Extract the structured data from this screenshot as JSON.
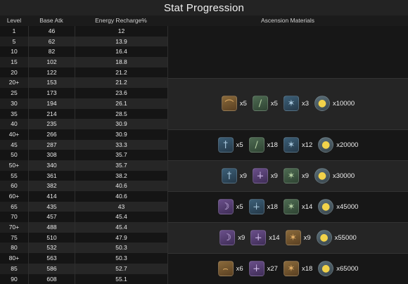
{
  "title": "Stat Progression",
  "headers": {
    "level": "Level",
    "base_atk": "Base Atk",
    "energy": "Energy Recharge%",
    "materials": "Ascension Materials"
  },
  "rows": [
    {
      "level": "1",
      "atk": "46",
      "er": "12"
    },
    {
      "level": "5",
      "atk": "62",
      "er": "13.9"
    },
    {
      "level": "10",
      "atk": "82",
      "er": "16.4"
    },
    {
      "level": "15",
      "atk": "102",
      "er": "18.8"
    },
    {
      "level": "20",
      "atk": "122",
      "er": "21.2"
    },
    {
      "level": "20+",
      "atk": "153",
      "er": "21.2"
    },
    {
      "level": "25",
      "atk": "173",
      "er": "23.6"
    },
    {
      "level": "30",
      "atk": "194",
      "er": "26.1"
    },
    {
      "level": "35",
      "atk": "214",
      "er": "28.5"
    },
    {
      "level": "40",
      "atk": "235",
      "er": "30.9"
    },
    {
      "level": "40+",
      "atk": "266",
      "er": "30.9"
    },
    {
      "level": "45",
      "atk": "287",
      "er": "33.3"
    },
    {
      "level": "50",
      "atk": "308",
      "er": "35.7"
    },
    {
      "level": "50+",
      "atk": "340",
      "er": "35.7"
    },
    {
      "level": "55",
      "atk": "361",
      "er": "38.2"
    },
    {
      "level": "60",
      "atk": "382",
      "er": "40.6"
    },
    {
      "level": "60+",
      "atk": "414",
      "er": "40.6"
    },
    {
      "level": "65",
      "atk": "435",
      "er": "43"
    },
    {
      "level": "70",
      "atk": "457",
      "er": "45.4"
    },
    {
      "level": "70+",
      "atk": "488",
      "er": "45.4"
    },
    {
      "level": "75",
      "atk": "510",
      "er": "47.9"
    },
    {
      "level": "80",
      "atk": "532",
      "er": "50.3"
    },
    {
      "level": "80+",
      "atk": "563",
      "er": "50.3"
    },
    {
      "level": "85",
      "atk": "586",
      "er": "52.7"
    },
    {
      "level": "90",
      "atk": "608",
      "er": "55.1"
    }
  ],
  "ascension": [
    {
      "items": [
        {
          "icon": "curved-blade-icon",
          "color": "orange",
          "qty": "x5"
        },
        {
          "icon": "blade-icon",
          "color": "green",
          "qty": "x5"
        },
        {
          "icon": "claw-icon",
          "color": "blue",
          "qty": "x3"
        },
        {
          "icon": "coin-icon",
          "color": "gold",
          "qty": "x10000"
        }
      ]
    },
    {
      "items": [
        {
          "icon": "staff-icon",
          "color": "blue",
          "qty": "x5"
        },
        {
          "icon": "blade-icon",
          "color": "green",
          "qty": "x18"
        },
        {
          "icon": "claw-icon",
          "color": "blue",
          "qty": "x12"
        },
        {
          "icon": "coin-icon",
          "color": "gold",
          "qty": "x20000"
        }
      ]
    },
    {
      "items": [
        {
          "icon": "staff-icon",
          "color": "blue",
          "qty": "x9"
        },
        {
          "icon": "dagger-icon",
          "color": "purple",
          "qty": "x9"
        },
        {
          "icon": "claw-icon",
          "color": "green",
          "qty": "x9"
        },
        {
          "icon": "coin-icon",
          "color": "gold",
          "qty": "x30000"
        }
      ]
    },
    {
      "items": [
        {
          "icon": "crescent-icon",
          "color": "purple",
          "qty": "x5"
        },
        {
          "icon": "dagger-icon",
          "color": "blue",
          "qty": "x18"
        },
        {
          "icon": "claw-icon",
          "color": "green",
          "qty": "x14"
        },
        {
          "icon": "coin-icon",
          "color": "gold",
          "qty": "x45000"
        }
      ]
    },
    {
      "items": [
        {
          "icon": "crescent-icon",
          "color": "purple",
          "qty": "x9"
        },
        {
          "icon": "dagger-icon",
          "color": "purple",
          "qty": "x14"
        },
        {
          "icon": "claw-icon",
          "color": "orange",
          "qty": "x9"
        },
        {
          "icon": "coin-icon",
          "color": "gold",
          "qty": "x55000"
        }
      ]
    },
    {
      "items": [
        {
          "icon": "horn-icon",
          "color": "orange",
          "qty": "x6"
        },
        {
          "icon": "dagger-icon",
          "color": "purple",
          "qty": "x27"
        },
        {
          "icon": "claw-icon",
          "color": "orange",
          "qty": "x18"
        },
        {
          "icon": "coin-icon",
          "color": "gold",
          "qty": "x65000"
        }
      ]
    }
  ]
}
